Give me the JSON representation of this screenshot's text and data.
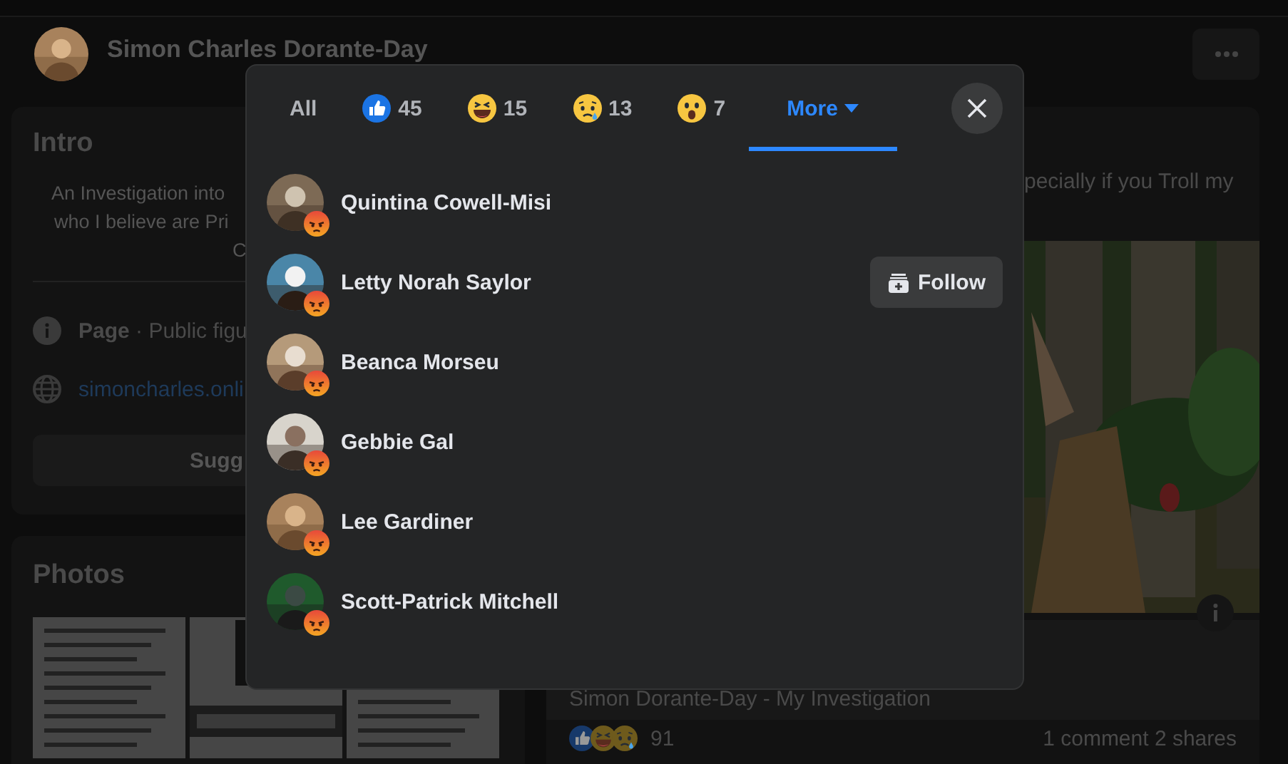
{
  "profile": {
    "name": "Simon Charles Dorante-Day"
  },
  "intro": {
    "title": "Intro",
    "bio_lines": [
      "An Investigation into",
      "who I believe are Pri",
      "C"
    ],
    "category": "**Page** · Public figu",
    "website": "simoncharles.onli",
    "button": "Sugg"
  },
  "photos": {
    "title": "Photos"
  },
  "post": {
    "text": "pecially if you Troll my",
    "caption": "Simon Dorante-Day - My Investigation",
    "reactions": [
      {
        "kind": "like"
      },
      {
        "kind": "haha"
      },
      {
        "kind": "sad"
      }
    ],
    "reaction_count": "91",
    "stats": "1 comment  2 shares"
  },
  "dialog": {
    "tabs": [
      {
        "kind": "all",
        "label": "All",
        "selected": false
      },
      {
        "kind": "like",
        "count": "45",
        "selected": false
      },
      {
        "kind": "haha",
        "count": "15",
        "selected": false
      },
      {
        "kind": "sad",
        "count": "13",
        "selected": false
      },
      {
        "kind": "wow",
        "count": "7",
        "selected": false
      },
      {
        "kind": "more",
        "label": "More",
        "selected": true
      }
    ],
    "people": [
      {
        "name": "Quintina Cowell-Misi",
        "kind": "angry"
      },
      {
        "name": "Letty Norah Saylor",
        "kind": "angry",
        "follow_button": "Follow"
      },
      {
        "name": "Beanca Morseu",
        "kind": "angry"
      },
      {
        "name": "Gebbie Gal",
        "kind": "angry"
      },
      {
        "name": "Lee Gardiner",
        "kind": "angry"
      },
      {
        "name": "Scott-Patrick Mitchell",
        "kind": "angry"
      }
    ]
  }
}
